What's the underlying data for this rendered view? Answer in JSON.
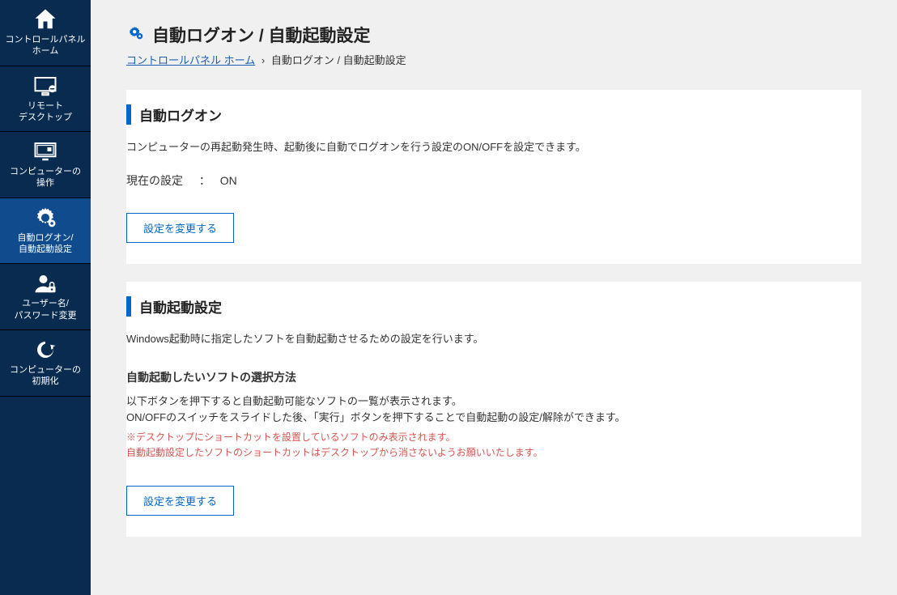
{
  "sidebar": {
    "items": [
      {
        "label": "コントロールパネル\nホーム"
      },
      {
        "label": "リモート\nデスクトップ"
      },
      {
        "label": "コンピューターの\n操作"
      },
      {
        "label": "自動ログオン/\n自動起動設定"
      },
      {
        "label": "ユーザー名/\nパスワード変更"
      },
      {
        "label": "コンピューターの\n初期化"
      }
    ]
  },
  "page": {
    "title": "自動ログオン / 自動起動設定"
  },
  "breadcrumb": {
    "root": "コントロールパネル ホーム",
    "sep": "›",
    "current": "自動ログオン / 自動起動設定"
  },
  "section1": {
    "heading": "自動ログオン",
    "desc": "コンピューターの再起動発生時、起動後に自動でログオンを行う設定のON/OFFを設定できます。",
    "state_label": "現在の設定",
    "state_colon": "：",
    "state_value": "ON",
    "button": "設定を変更する"
  },
  "section2": {
    "heading": "自動起動設定",
    "desc": "Windows起動時に指定したソフトを自動起動させるための設定を行います。",
    "sub_heading": "自動起動したいソフトの選択方法",
    "desc2_line1": "以下ボタンを押下すると自動起動可能なソフトの一覧が表示されます。",
    "desc2_line2": "ON/OFFのスイッチをスライドした後、「実行」ボタンを押下することで自動起動の設定/解除ができます。",
    "note_line1": "※デスクトップにショートカットを設置しているソフトのみ表示されます。",
    "note_line2": "自動起動設定したソフトのショートカットはデスクトップから消さないようお願いいたします。",
    "button": "設定を変更する"
  }
}
